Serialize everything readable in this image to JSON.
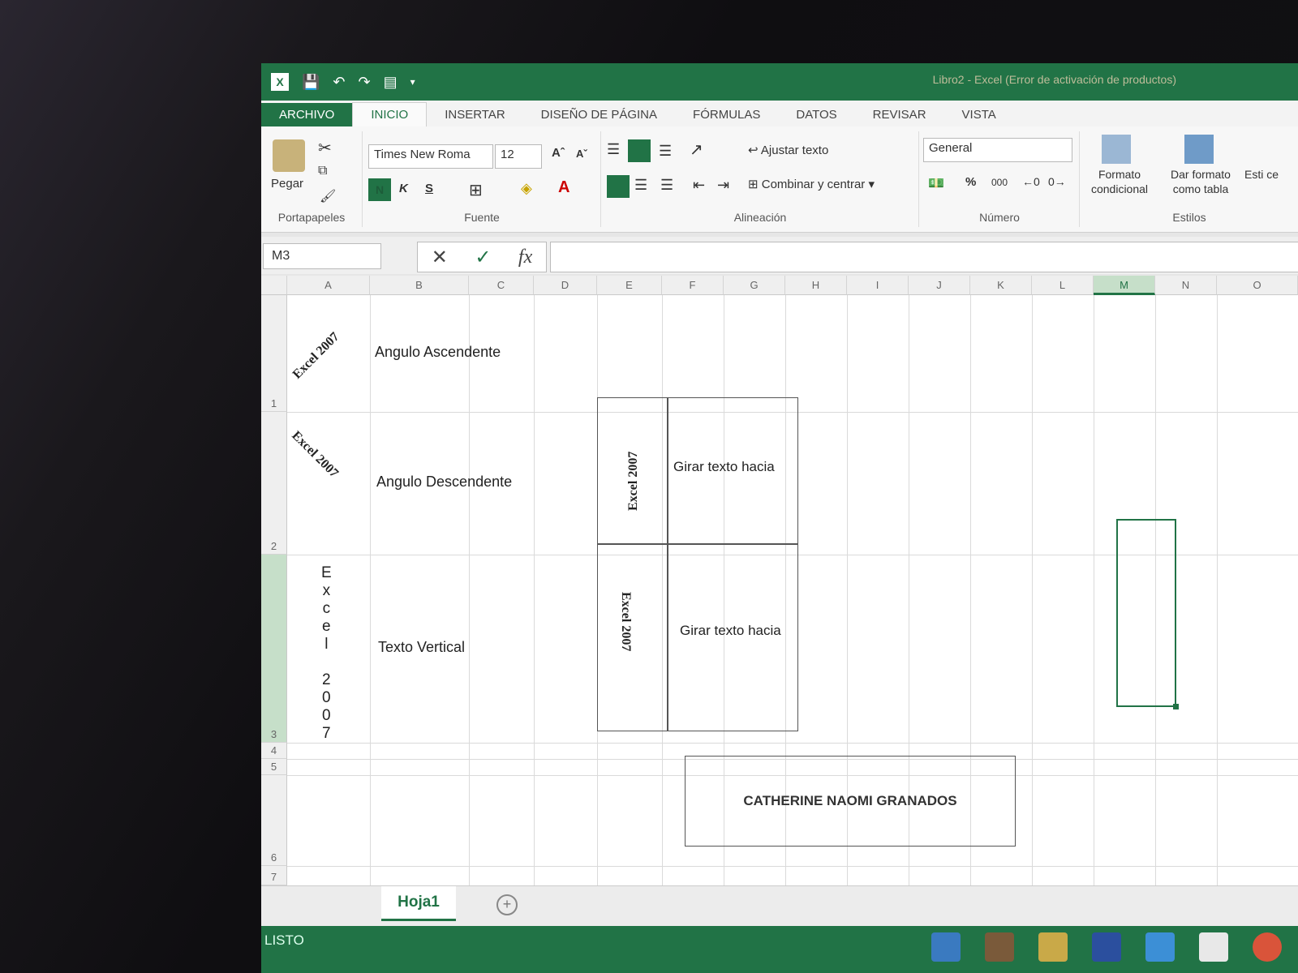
{
  "window": {
    "title": "Libro2 - Excel (Error de activación de productos)"
  },
  "tabs": [
    "ARCHIVO",
    "INICIO",
    "INSERTAR",
    "DISEÑO DE PÁGINA",
    "FÓRMULAS",
    "DATOS",
    "REVISAR",
    "VISTA"
  ],
  "ribbon": {
    "clipboard": {
      "paste": "Pegar",
      "label": "Portapapeles"
    },
    "font": {
      "name": "Times New Roma",
      "size": "12",
      "bold": "N",
      "italic": "K",
      "underline": "S",
      "label": "Fuente"
    },
    "alignment": {
      "wrap": "Ajustar texto",
      "merge": "Combinar y centrar",
      "label": "Alineación"
    },
    "number": {
      "format": "General",
      "percent": "%",
      "thousands": "000",
      "label": "Número"
    },
    "styles": {
      "conditional": "Formato condicional",
      "as_table": "Dar formato como tabla",
      "label": "Estilos",
      "cell_styles": "Esti ce"
    }
  },
  "formula_bar": {
    "name_box": "M3",
    "cancel": "✕",
    "enter": "✓",
    "fx": "fx",
    "value": ""
  },
  "columns": [
    "A",
    "B",
    "C",
    "D",
    "E",
    "F",
    "G",
    "H",
    "I",
    "J",
    "K",
    "L",
    "M",
    "N",
    "O"
  ],
  "rows": [
    "1",
    "2",
    "3",
    "4",
    "5",
    "6",
    "7"
  ],
  "cells": {
    "a1": "Excel 2007",
    "a2": "Excel 2007",
    "a3_chars": [
      "E",
      "x",
      "c",
      "e",
      "l",
      "",
      "2",
      "0",
      "0",
      "7"
    ],
    "b1": "Angulo Ascendente",
    "b2": "Angulo Descendente",
    "b3": "Texto Vertical",
    "e2": "Excel 2007",
    "f2": "Girar texto hacia",
    "e3": "Excel 2007",
    "f3": "Girar texto hacia",
    "name_box_cell": "CATHERINE NAOMI GRANADOS"
  },
  "sheet": {
    "tab": "Hoja1",
    "add": "+"
  },
  "status": {
    "text": "LISTO"
  },
  "colors": {
    "accent": "#217346"
  }
}
